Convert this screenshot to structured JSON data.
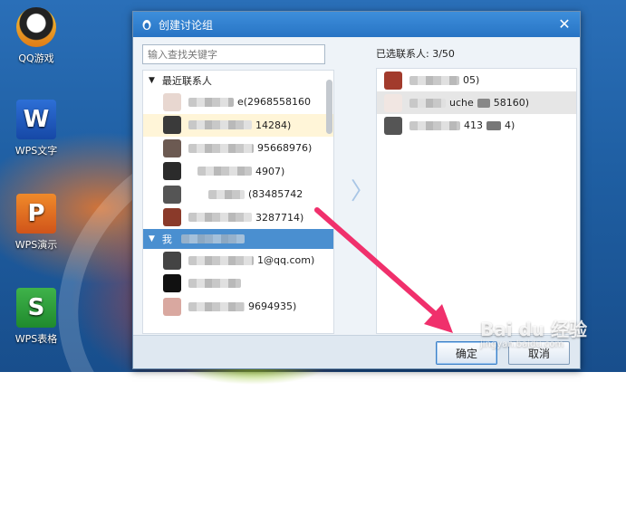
{
  "desktop": {
    "icons": [
      {
        "label": "QQ游戏",
        "glyph": ""
      },
      {
        "label": "WPS文字",
        "glyph": "W"
      },
      {
        "label": "WPS演示",
        "glyph": "P"
      },
      {
        "label": "WPS表格",
        "glyph": "S"
      }
    ]
  },
  "dialog": {
    "title": "创建讨论组",
    "close_glyph": "✕",
    "search_placeholder": "输入查找关键字",
    "groups": [
      {
        "label": "最近联系人",
        "expanded": true
      },
      {
        "label": "我",
        "expanded": true
      }
    ],
    "recent_contacts": [
      {
        "text": "e(2968558160",
        "color": "#e8d7d0"
      },
      {
        "text": "14284)",
        "color": "#3a3a3a"
      },
      {
        "text": "95668976)",
        "color": "#6c5a52"
      },
      {
        "text": "4907)",
        "color": "#2b2b2b"
      },
      {
        "text": "(83485742",
        "color": "#555"
      },
      {
        "text": "3287714)",
        "color": "#8a3a2a"
      }
    ],
    "my_contacts": [
      {
        "text": "1@qq.com)",
        "color": "#444"
      },
      {
        "text": "",
        "color": "#111"
      },
      {
        "text": "9694935)",
        "color": "#d9a8a0"
      }
    ],
    "move_glyph": "〉",
    "selected_label": "已选联系人: 3/50",
    "selected_contacts": [
      {
        "text": "05)",
        "color": "#a23b2c"
      },
      {
        "text": "uche",
        "tail": "58160)",
        "color": "#f1e6e2"
      },
      {
        "text": "413",
        "tail": "4)",
        "color": "#555"
      }
    ],
    "ok_label": "确定",
    "cancel_label": "取消"
  },
  "watermark": {
    "brand": "Bai du",
    "sub": "经验",
    "url": "jingyan.baidu.com"
  }
}
